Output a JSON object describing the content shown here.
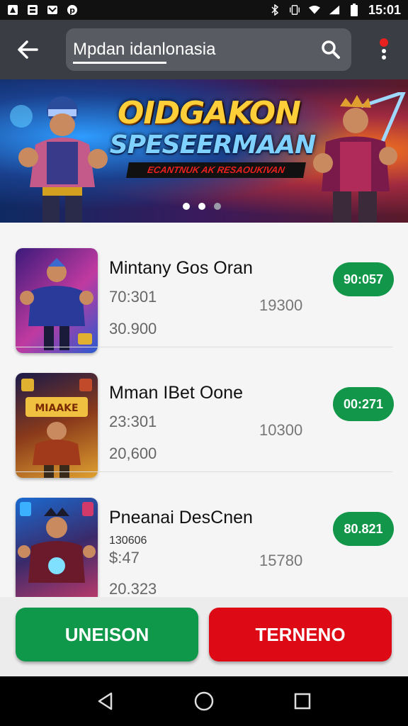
{
  "status_bar": {
    "time": "15:01",
    "left_icons": [
      "notification-icon",
      "gallery-icon",
      "mail-icon",
      "pinterest-icon"
    ],
    "right_icons": [
      "bluetooth-icon",
      "vibrate-icon",
      "wifi-icon",
      "signal-icon",
      "battery-icon"
    ]
  },
  "app_bar": {
    "search_value": "Mpdan idanlonasia",
    "icons": [
      "back-arrow-icon",
      "search-icon",
      "more-menu-icon"
    ],
    "menu_dot_color": "#e8201e"
  },
  "banner": {
    "title": "OIDGAKON",
    "subtitle": "SPESEERMAAN",
    "tagline": "ECANTNUK AK RESAOUKIVAN",
    "slide_index": 2,
    "slide_count": 3
  },
  "items": [
    {
      "title": "Mintany Gos Oran",
      "price": "70:301",
      "sub": "30.900",
      "count": "19300",
      "button": "90:057"
    },
    {
      "title": "Mman IBet Oone",
      "price": "23:301",
      "sub": "20,600",
      "count": "10300",
      "button": "00:271"
    },
    {
      "title": "Pneanai DesCnen",
      "small": "130606",
      "price": "$:47",
      "sub": "20.323",
      "count": "15780",
      "button": "80.821"
    }
  ],
  "actions": {
    "primary": "UNEISON",
    "secondary": "TERNENO",
    "primary_color": "#10984a",
    "secondary_color": "#dd0a15"
  },
  "nav_bar": {
    "icons": [
      "back-triangle-icon",
      "home-circle-icon",
      "recents-square-icon"
    ]
  }
}
